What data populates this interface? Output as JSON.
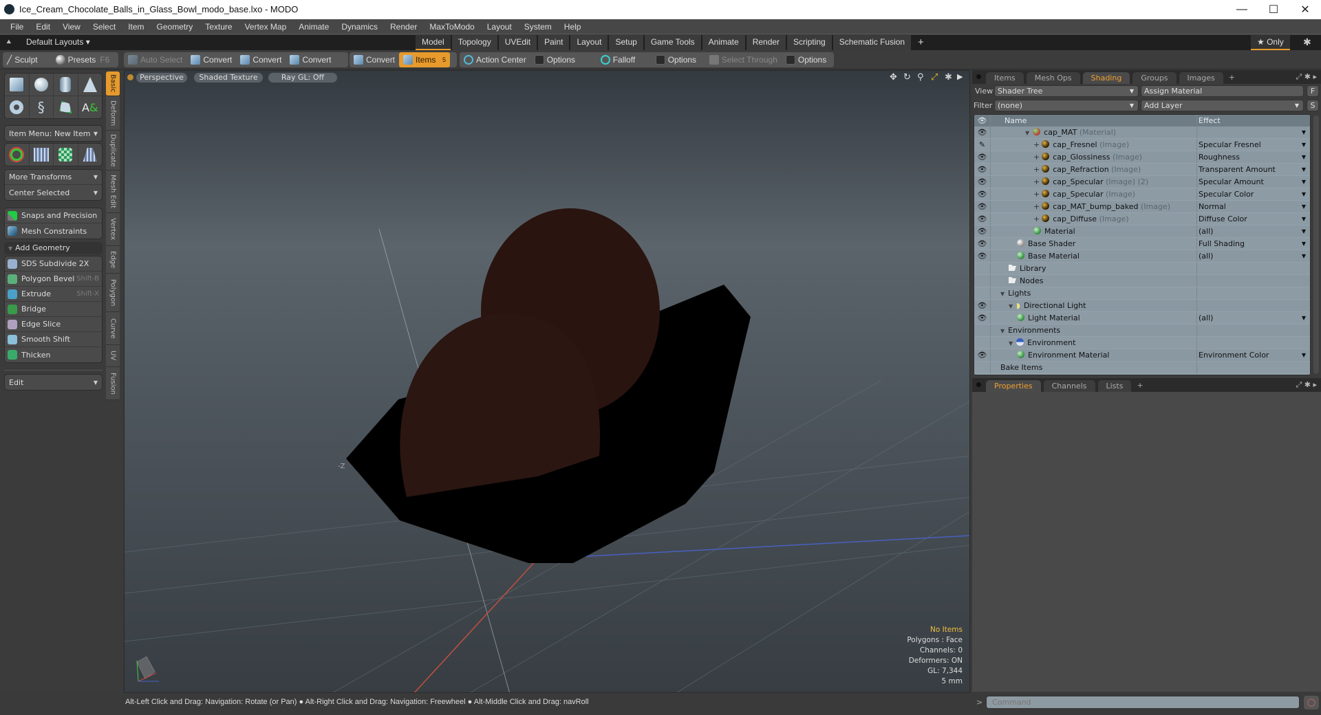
{
  "window": {
    "title": "Ice_Cream_Chocolate_Balls_in_Glass_Bowl_modo_base.lxo - MODO",
    "minimize": "—",
    "maximize": "☐",
    "close": "✕"
  },
  "menu": [
    "File",
    "Edit",
    "View",
    "Select",
    "Item",
    "Geometry",
    "Texture",
    "Vertex Map",
    "Animate",
    "Dynamics",
    "Render",
    "MaxToModo",
    "Layout",
    "System",
    "Help"
  ],
  "layoutbar": {
    "default_layouts": "Default Layouts ▾",
    "tabs": [
      "Model",
      "Topology",
      "UVEdit",
      "Paint",
      "Layout",
      "Setup",
      "Game Tools",
      "Animate",
      "Render",
      "Scripting",
      "Schematic Fusion"
    ],
    "active_tab": "Model",
    "add": "+",
    "only": "★ Only"
  },
  "toolbar": {
    "sculpt": "Sculpt",
    "presets": "Presets",
    "presets_key": "F6",
    "auto_select": "Auto Select",
    "convert": "Convert",
    "items": "Items",
    "items_count": "5",
    "action_center": "Action Center",
    "options": "Options",
    "falloff": "Falloff",
    "select_through": "Select Through"
  },
  "left": {
    "item_menu": "Item Menu: New Item",
    "more_transforms": "More Transforms",
    "center_selected": "Center Selected",
    "snaps": "Snaps and Precision",
    "mesh_constraints": "Mesh Constraints",
    "add_geometry": "Add Geometry",
    "tools": [
      {
        "label": "SDS Subdivide 2X",
        "shortcut": ""
      },
      {
        "label": "Polygon Bevel",
        "shortcut": "Shift-B"
      },
      {
        "label": "Extrude",
        "shortcut": "Shift-X"
      },
      {
        "label": "Bridge",
        "shortcut": ""
      },
      {
        "label": "Edge Slice",
        "shortcut": ""
      },
      {
        "label": "Smooth Shift",
        "shortcut": ""
      },
      {
        "label": "Thicken",
        "shortcut": ""
      }
    ],
    "edit": "Edit",
    "vtabs": [
      "Basic",
      "Deform",
      "Duplicate",
      "Mesh Edit",
      "Vertex",
      "Edge",
      "Polygon",
      "Curve",
      "UV",
      "Fusion"
    ]
  },
  "viewport": {
    "perspective": "Perspective",
    "shading": "Shaded Texture",
    "raygl": "Ray GL: Off",
    "info": {
      "items": "No Items",
      "polygons": "Polygons : Face",
      "channels": "Channels: 0",
      "deformers": "Deformers: ON",
      "gl": "GL: 7,344",
      "scale": "5 mm"
    },
    "axis_label": "-Z"
  },
  "shading": {
    "tabs": [
      "Items",
      "Mesh Ops",
      "Shading",
      "Groups",
      "Images"
    ],
    "active": "Shading",
    "view_label": "View",
    "view_value": "Shader Tree",
    "assign": "Assign Material",
    "f": "F",
    "filter_label": "Filter",
    "filter_value": "(none)",
    "add_layer": "Add Layer",
    "s": "S",
    "col_name": "Name",
    "col_effect": "Effect",
    "rows": [
      {
        "eye": "👁",
        "indent": 3,
        "icon": "b-mm",
        "name": "cap_MAT",
        "type": "(Material)",
        "effect": "",
        "dd": true,
        "tri": "▼"
      },
      {
        "eye": "✎",
        "indent": 4,
        "icon": "b-img",
        "name": "cap_Fresnel",
        "type": "(Image)",
        "effect": "Specular Fresnel",
        "dd": true,
        "plus": true
      },
      {
        "eye": "👁",
        "indent": 4,
        "icon": "b-img",
        "name": "cap_Glossiness",
        "type": "(Image)",
        "effect": "Roughness",
        "dd": true,
        "plus": true
      },
      {
        "eye": "👁",
        "indent": 4,
        "icon": "b-img",
        "name": "cap_Refraction",
        "type": "(Image)",
        "effect": "Transparent Amount",
        "dd": true,
        "plus": true
      },
      {
        "eye": "👁",
        "indent": 4,
        "icon": "b-img",
        "name": "cap_Specular",
        "type": "(Image) (2)",
        "effect": "Specular Amount",
        "dd": true,
        "plus": true
      },
      {
        "eye": "👁",
        "indent": 4,
        "icon": "b-img",
        "name": "cap_Specular",
        "type": "(Image)",
        "effect": "Specular Color",
        "dd": true,
        "plus": true
      },
      {
        "eye": "👁",
        "indent": 4,
        "icon": "b-img",
        "name": "cap_MAT_bump_baked",
        "type": "(Image)",
        "effect": "Normal",
        "dd": true,
        "plus": true
      },
      {
        "eye": "👁",
        "indent": 4,
        "icon": "b-img",
        "name": "cap_Diffuse",
        "type": "(Image)",
        "effect": "Diffuse Color",
        "dd": true,
        "plus": true
      },
      {
        "eye": "👁",
        "indent": 4,
        "icon": "b-mat",
        "name": "Material",
        "type": "",
        "effect": "(all)",
        "dd": true
      },
      {
        "eye": "👁",
        "indent": 2,
        "icon": "b-base",
        "name": "Base Shader",
        "type": "",
        "effect": "Full Shading",
        "dd": true
      },
      {
        "eye": "👁",
        "indent": 2,
        "icon": "b-mat",
        "name": "Base Material",
        "type": "",
        "effect": "(all)",
        "dd": true
      },
      {
        "eye": "",
        "indent": 1,
        "icon": "folder",
        "name": "Library",
        "type": "",
        "effect": ""
      },
      {
        "eye": "",
        "indent": 1,
        "icon": "folder",
        "name": "Nodes",
        "type": "",
        "effect": ""
      },
      {
        "eye": "",
        "indent": 0,
        "icon": "",
        "name": "Lights",
        "type": "",
        "effect": "",
        "tri": "▼"
      },
      {
        "eye": "👁",
        "indent": 1,
        "icon": "light",
        "name": "Directional Light",
        "type": "",
        "effect": "",
        "tri": "▼"
      },
      {
        "eye": "👁",
        "indent": 2,
        "icon": "b-mat",
        "name": "Light Material",
        "type": "",
        "effect": "(all)",
        "dd": true
      },
      {
        "eye": "",
        "indent": 0,
        "icon": "",
        "name": "Environments",
        "type": "",
        "effect": "",
        "tri": "▼"
      },
      {
        "eye": "",
        "indent": 1,
        "icon": "b-env",
        "name": "Environment",
        "type": "",
        "effect": "",
        "tri": "▼"
      },
      {
        "eye": "👁",
        "indent": 2,
        "icon": "b-mat",
        "name": "Environment Material",
        "type": "",
        "effect": "Environment Color",
        "dd": true
      },
      {
        "eye": "",
        "indent": 0,
        "icon": "",
        "name": "Bake Items",
        "type": "",
        "effect": ""
      }
    ]
  },
  "properties": {
    "tabs": [
      "Properties",
      "Channels",
      "Lists"
    ],
    "active": "Properties"
  },
  "status": {
    "hint1": "Alt-Left Click and Drag: Navigation: Rotate (or Pan)",
    "hint2": "Alt-Right Click and Drag: Navigation: Freewheel",
    "hint3": "Alt-Middle Click and Drag: navRoll"
  },
  "command": {
    "prompt": ">",
    "placeholder": "Command"
  }
}
